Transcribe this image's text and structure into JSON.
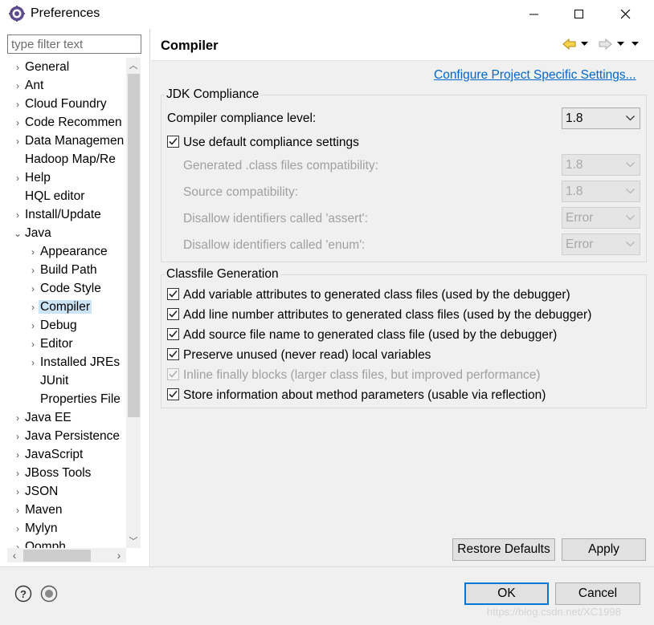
{
  "window": {
    "title": "Preferences"
  },
  "filter": {
    "placeholder": "type filter text"
  },
  "tree": [
    {
      "label": "General",
      "level": 0,
      "expander": "collapsed"
    },
    {
      "label": "Ant",
      "level": 0,
      "expander": "collapsed"
    },
    {
      "label": "Cloud Foundry",
      "level": 0,
      "expander": "collapsed"
    },
    {
      "label": "Code Recommen",
      "level": 0,
      "expander": "collapsed"
    },
    {
      "label": "Data Managemen",
      "level": 0,
      "expander": "collapsed"
    },
    {
      "label": "Hadoop Map/Re",
      "level": 0,
      "expander": "none"
    },
    {
      "label": "Help",
      "level": 0,
      "expander": "collapsed"
    },
    {
      "label": "HQL editor",
      "level": 0,
      "expander": "none"
    },
    {
      "label": "Install/Update",
      "level": 0,
      "expander": "collapsed"
    },
    {
      "label": "Java",
      "level": 0,
      "expander": "expanded"
    },
    {
      "label": "Appearance",
      "level": 1,
      "expander": "collapsed"
    },
    {
      "label": "Build Path",
      "level": 1,
      "expander": "collapsed"
    },
    {
      "label": "Code Style",
      "level": 1,
      "expander": "collapsed"
    },
    {
      "label": "Compiler",
      "level": 1,
      "expander": "collapsed",
      "selected": true
    },
    {
      "label": "Debug",
      "level": 1,
      "expander": "collapsed"
    },
    {
      "label": "Editor",
      "level": 1,
      "expander": "collapsed"
    },
    {
      "label": "Installed JREs",
      "level": 1,
      "expander": "collapsed"
    },
    {
      "label": "JUnit",
      "level": 1,
      "expander": "none"
    },
    {
      "label": "Properties File",
      "level": 1,
      "expander": "none"
    },
    {
      "label": "Java EE",
      "level": 0,
      "expander": "collapsed"
    },
    {
      "label": "Java Persistence",
      "level": 0,
      "expander": "collapsed"
    },
    {
      "label": "JavaScript",
      "level": 0,
      "expander": "collapsed"
    },
    {
      "label": "JBoss Tools",
      "level": 0,
      "expander": "collapsed"
    },
    {
      "label": "JSON",
      "level": 0,
      "expander": "collapsed"
    },
    {
      "label": "Maven",
      "level": 0,
      "expander": "collapsed"
    },
    {
      "label": "Mylyn",
      "level": 0,
      "expander": "collapsed"
    },
    {
      "label": "Oomph",
      "level": 0,
      "expander": "collapsed"
    }
  ],
  "page": {
    "title": "Compiler",
    "config_link": "Configure Project Specific Settings..."
  },
  "jdk": {
    "legend": "JDK Compliance",
    "level_label": "Compiler compliance level:",
    "level_value": "1.8",
    "use_default_label": "Use default compliance settings",
    "use_default_checked": true,
    "generated_label": "Generated .class files compatibility:",
    "generated_value": "1.8",
    "source_label": "Source compatibility:",
    "source_value": "1.8",
    "assert_label": "Disallow identifiers called 'assert':",
    "assert_value": "Error",
    "enum_label": "Disallow identifiers called 'enum':",
    "enum_value": "Error"
  },
  "classfile": {
    "legend": "Classfile Generation",
    "options": [
      {
        "label": "Add variable attributes to generated class files (used by the debugger)",
        "checked": true,
        "enabled": true
      },
      {
        "label": "Add line number attributes to generated class files (used by the debugger)",
        "checked": true,
        "enabled": true
      },
      {
        "label": "Add source file name to generated class file (used by the debugger)",
        "checked": true,
        "enabled": true
      },
      {
        "label": "Preserve unused (never read) local variables",
        "checked": true,
        "enabled": true
      },
      {
        "label": "Inline finally blocks (larger class files, but improved performance)",
        "checked": true,
        "enabled": false
      },
      {
        "label": "Store information about method parameters (usable via reflection)",
        "checked": true,
        "enabled": true
      }
    ]
  },
  "buttons": {
    "restore": "Restore Defaults",
    "apply": "Apply",
    "ok": "OK",
    "cancel": "Cancel"
  },
  "watermark": "https://blog.csdn.net/XC1998",
  "colors": {
    "link": "#0066cc",
    "selection": "#cce4f7",
    "default_button_border": "#0078d7"
  }
}
